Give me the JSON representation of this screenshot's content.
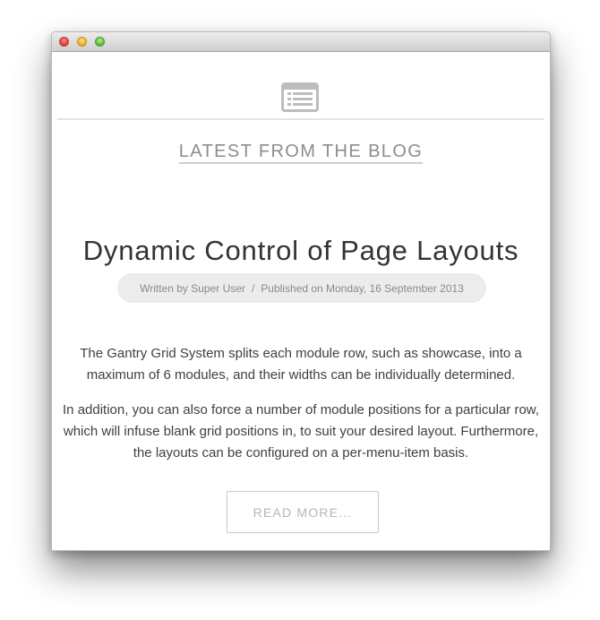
{
  "blog": {
    "icon": "blog-list-icon",
    "section_heading": "LATEST FROM THE BLOG"
  },
  "post": {
    "title": "Dynamic Control of Page Layouts",
    "meta": {
      "author": "Written by Super User",
      "separator": "/",
      "published": "Published on Monday, 16 September 2013"
    },
    "paragraphs": [
      "The Gantry Grid System splits each module row, such as showcase, into a maximum of 6 modules, and their widths can be individually determined.",
      "In addition, you can also force a number of module positions for a particular row, which will infuse blank grid positions in, to suit your desired layout. Furthermore, the layouts can be configured on a per-menu-item basis."
    ],
    "read_more_label": "READ MORE..."
  },
  "colors": {
    "window_background": "#ffffff",
    "meta_pill": "#ececec",
    "heading_text": "#8d8d8d",
    "title_text": "#333333",
    "body_text": "#404040"
  }
}
